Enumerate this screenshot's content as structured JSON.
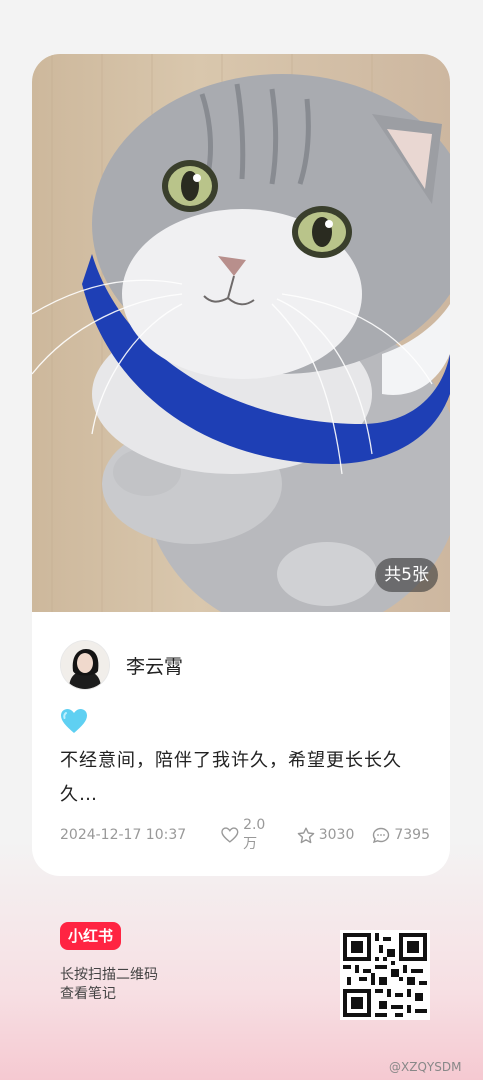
{
  "post": {
    "image_count_badge": "共5张",
    "author_name": "李云霄",
    "content_emoji": "light-blue-heart-emoji",
    "content_text": "不经意间，陪伴了我许久，希望更长长久久…",
    "date": "2024-12-17 10:37",
    "likes": "2.0万",
    "favorites": "3030",
    "comments": "7395"
  },
  "footer": {
    "brand": "小红书",
    "line1": "长按扫描二维码",
    "line2": "查看笔记",
    "watermark": "@XZQYSDM"
  },
  "colors": {
    "brand_red": "#ff2442",
    "heart_blue": "#5fd0f2",
    "collar_blue": "#1e3fb5"
  },
  "icons": [
    "heart-icon",
    "star-icon",
    "comment-icon",
    "qr-code",
    "weibo-logo"
  ]
}
